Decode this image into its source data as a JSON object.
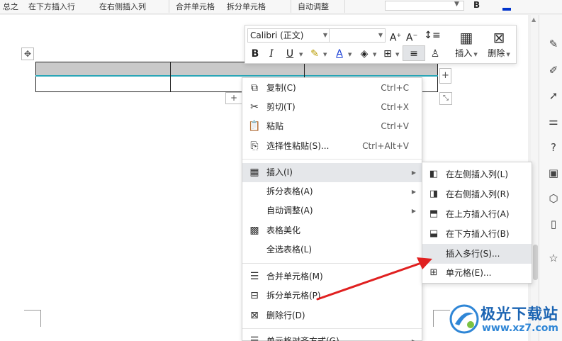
{
  "ribbon": {
    "items": [
      "总之",
      "在下方插入行",
      "在右侧插入列",
      "合并单元格",
      "拆分单元格",
      "自动调整"
    ]
  },
  "mini_toolbar": {
    "font_name": "Calibri (正文)",
    "font_size": "",
    "insert_label": "插入",
    "delete_label": "删除"
  },
  "context_menu": {
    "items": [
      {
        "label": "复制(C)",
        "shortcut": "Ctrl+C",
        "icon": "copy-icon"
      },
      {
        "label": "剪切(T)",
        "shortcut": "Ctrl+X",
        "icon": "scissors-icon"
      },
      {
        "label": "粘贴",
        "shortcut": "Ctrl+V",
        "icon": "paste-icon"
      },
      {
        "label": "选择性粘贴(S)...",
        "shortcut": "Ctrl+Alt+V",
        "icon": "paste-special-icon"
      },
      {
        "label": "插入(I)",
        "icon": "table-icon",
        "submenu": true
      },
      {
        "label": "拆分表格(A)",
        "submenu": true
      },
      {
        "label": "自动调整(A)",
        "submenu": true
      },
      {
        "label": "表格美化",
        "icon": "table-style-icon"
      },
      {
        "label": "全选表格(L)"
      },
      {
        "label": "合并单元格(M)",
        "icon": "merge-cells-icon"
      },
      {
        "label": "拆分单元格(P)",
        "icon": "split-cells-icon"
      },
      {
        "label": "删除行(D)",
        "icon": "delete-row-icon"
      },
      {
        "label": "单元格对齐方式(G)",
        "submenu": true
      }
    ]
  },
  "submenu": {
    "items": [
      {
        "label": "在左侧插入列(L)",
        "icon": "insert-col-left-icon"
      },
      {
        "label": "在右侧插入列(R)",
        "icon": "insert-col-right-icon"
      },
      {
        "label": "在上方插入行(A)",
        "icon": "insert-row-above-icon"
      },
      {
        "label": "在下方插入行(B)",
        "icon": "insert-row-below-icon"
      },
      {
        "label": "插入多行(S)..."
      },
      {
        "label": "单元格(E)...",
        "icon": "insert-cell-icon"
      }
    ],
    "highlighted_index": 4
  },
  "watermark": {
    "title": "极光下载站",
    "url": "www.xz7.com"
  },
  "colors": {
    "accent_teal": "#2aa6b7",
    "arrow_red": "#e02020",
    "menu_highlight": "#e5e7ea",
    "watermark_blue": "#1b64b3"
  }
}
